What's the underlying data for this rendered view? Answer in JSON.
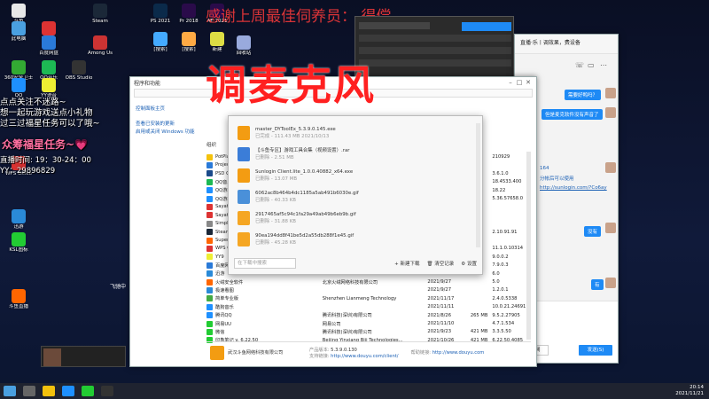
{
  "banner_top": "感谢上周最佳伺养员：   得偿",
  "banner_big": "调麦克风",
  "overlay": {
    "lines": [
      "点点关注不迷路~",
      "想一起玩游戏送点小礼物",
      "过三过福星任务可以了哦~"
    ],
    "task": "众筹福星任务~💗",
    "live_time_label": "直播时间: 19：30-24：00",
    "yy": "YY：29896829",
    "flying": "飞驰中"
  },
  "desktop_icons": [
    {
      "label": "斗鱼",
      "color": "#e8e8e8"
    },
    {
      "label": "此电脑",
      "color": "#4aa0e0"
    },
    {
      "label": "网易云",
      "color": "#d33"
    },
    {
      "label": "Steam",
      "color": "#1b2838"
    },
    {
      "label": "PS 2021",
      "color": "#0b2a4a"
    },
    {
      "label": "Pr 2018",
      "color": "#2a0b4a"
    },
    {
      "label": "AE 2021",
      "color": "#2a0b4a"
    },
    {
      "label": "回收站",
      "color": "#9ad"
    },
    {
      "label": "百度网盘",
      "color": "#2a7ad8"
    },
    {
      "label": "Among Us",
      "color": "#c33"
    },
    {
      "label": "[搜索]",
      "color": "#4af"
    },
    {
      "label": "[搜索]",
      "color": "#fa4"
    },
    {
      "label": "新建",
      "color": "#dd4"
    },
    {
      "label": "360安全卫士",
      "color": "#3a3"
    },
    {
      "label": "QQ音乐",
      "color": "#1db954"
    },
    {
      "label": "OBS Studio",
      "color": "#333"
    },
    {
      "label": "QQ",
      "color": "#1e90ff"
    },
    {
      "label": "WPS Office",
      "color": "#d33"
    },
    {
      "label": "迅游",
      "color": "#2a8ad8"
    },
    {
      "label": "YY语音",
      "color": "#ee3"
    },
    {
      "label": "KSL图标",
      "color": "#2c3"
    },
    {
      "label": "斗鱼直播",
      "color": "#f60"
    }
  ],
  "control_panel": {
    "title": "程序和功能",
    "nav_links": [
      "控制面板主页",
      "查看已安装的更新",
      "启用或关闭 Windows 功能"
    ],
    "organize": "组织",
    "programs": [
      {
        "name": "PotPlayer",
        "pub": "",
        "date": "",
        "size": "",
        "ver": "210929",
        "color": "#f4c20d"
      },
      {
        "name": "Project",
        "pub": "",
        "date": "",
        "size": "",
        "ver": "",
        "color": "#2a7ad8"
      },
      {
        "name": "PSD C",
        "pub": "",
        "date": "",
        "size": "",
        "ver": "3.6.1.0",
        "color": "#1b4a8a"
      },
      {
        "name": "QQ音乐",
        "pub": "",
        "date": "",
        "size": "",
        "ver": "18.4533.400",
        "color": "#1db954"
      },
      {
        "name": "QQ游戏",
        "pub": "",
        "date": "",
        "size": "",
        "ver": "18.22",
        "color": "#1e90ff"
      },
      {
        "name": "QQ游戏",
        "pub": "",
        "date": "",
        "size": "",
        "ver": "5.36.57658.0",
        "color": "#1e90ff"
      },
      {
        "name": "Sayatoo",
        "pub": "",
        "date": "",
        "size": "",
        "ver": "",
        "color": "#d33"
      },
      {
        "name": "Sayatoo",
        "pub": "",
        "date": "",
        "size": "",
        "ver": "",
        "color": "#d33"
      },
      {
        "name": "Simple",
        "pub": "",
        "date": "",
        "size": "",
        "ver": "",
        "color": "#888"
      },
      {
        "name": "Steam",
        "pub": "",
        "date": "",
        "size": "",
        "ver": "2.10.91.91",
        "color": "#1b2838"
      },
      {
        "name": "Super",
        "pub": "",
        "date": "",
        "size": "",
        "ver": "",
        "color": "#f60"
      },
      {
        "name": "WPS O",
        "pub": "",
        "date": "",
        "size": "",
        "ver": "11.1.0.10314",
        "color": "#d33"
      },
      {
        "name": "YY9",
        "pub": "",
        "date": "",
        "size": "",
        "ver": "9.0.0.2",
        "color": "#ee3"
      },
      {
        "name": "百度网",
        "pub": "",
        "date": "",
        "size": "",
        "ver": "7.9.0.3",
        "color": "#2a7ad8"
      },
      {
        "name": "迅游",
        "pub": "",
        "date": "",
        "size": "",
        "ver": "6.0",
        "color": "#2a8ad8"
      },
      {
        "name": "火绒安全软件",
        "pub": "北京火绒网络科技有限公司",
        "date": "2021/9/27",
        "size": "",
        "ver": "5.0",
        "color": "#f60"
      },
      {
        "name": "极速看图",
        "pub": "",
        "date": "2021/9/27",
        "size": "",
        "ver": "1.2.0.1",
        "color": "#2a8ad8"
      },
      {
        "name": "简单专业版",
        "pub": "Shenzhen Lianmeng Technology",
        "date": "2021/11/17",
        "size": "",
        "ver": "2.4.0.5338",
        "color": "#4a4"
      },
      {
        "name": "酷狗音乐",
        "pub": "",
        "date": "2021/11/11",
        "size": "",
        "ver": "10.0.21.24691",
        "color": "#1e90ff"
      },
      {
        "name": "腾讯QQ",
        "pub": "腾讯科技(深圳)有限公司",
        "date": "2021/8/26",
        "size": "265 MB",
        "ver": "9.5.2.27905",
        "color": "#1e90ff"
      },
      {
        "name": "网易UU",
        "pub": "网易公司",
        "date": "2021/11/10",
        "size": "",
        "ver": "4.7.1.534",
        "color": "#2c3"
      },
      {
        "name": "微信",
        "pub": "腾讯科技(深圳)有限公司",
        "date": "2021/9/23",
        "size": "421 MB",
        "ver": "3.3.5.50",
        "color": "#2c3"
      },
      {
        "name": "印象笔记 v. 6.22.50",
        "pub": "Beijing Yinxiang Biji Technologies...",
        "date": "2021/10/26",
        "size": "421 MB",
        "ver": "6.22.50.4085",
        "color": "#2c3"
      }
    ],
    "footer": {
      "company": "武汉斗鱼网络科技有限公司",
      "ver_label": "产品版本:",
      "ver": "5.3.9.0.130",
      "help_label": "帮助链接:",
      "help": "http://www.douyu.com",
      "support_label": "支持链接:",
      "support": "http://www.douyu.com/client/"
    }
  },
  "download_popup": {
    "items": [
      {
        "name": "master_DYToolEx_5.3.9.0.145.exe",
        "status": "已完成 - 111.43 MB   2021/10/13",
        "color": "#f39c12"
      },
      {
        "name": "【斗鱼专区】游戏工具合集（视频设置）.rar",
        "status": "已删除 - 2.51 MB",
        "color": "#3b7dd8"
      },
      {
        "name": "Sunlogin Client.lite_1.0.0.40882_x64.exe",
        "status": "已删除 - 13.07 MB",
        "color": "#f39c12"
      },
      {
        "name": "6062ac8b464b4dc1185a5ab491b6030e.gif",
        "status": "已删除 - 40.33 KB",
        "color": "#4a90d9"
      },
      {
        "name": "2917465af5c94c1fa29a49ab49b6eb9b.gif",
        "status": "已删除 - 31.88 KB",
        "color": "#f5a623"
      },
      {
        "name": "90ea194dd8f41be5d2a55db288f1e45.gif",
        "status": "已删除 - 45.28 KB",
        "color": "#f5a623"
      }
    ],
    "search_placeholder": "在下载中搜索",
    "new_download": "新建下载",
    "clear_record": "清空记录",
    "settings": "设置"
  },
  "chat": {
    "title": "直播·乐丨调效果，费设备",
    "messages": [
      "需要好鸭吗？",
      "但是麦克软件没有声音了",
      "164",
      "分帐后可以使用",
      "http://sunlogin.com/?Co6ay",
      "没有",
      "有"
    ],
    "send": "发送(S)",
    "close": "关闭"
  },
  "taskbar": {
    "time": "20:14",
    "date": "2021/11/21"
  }
}
